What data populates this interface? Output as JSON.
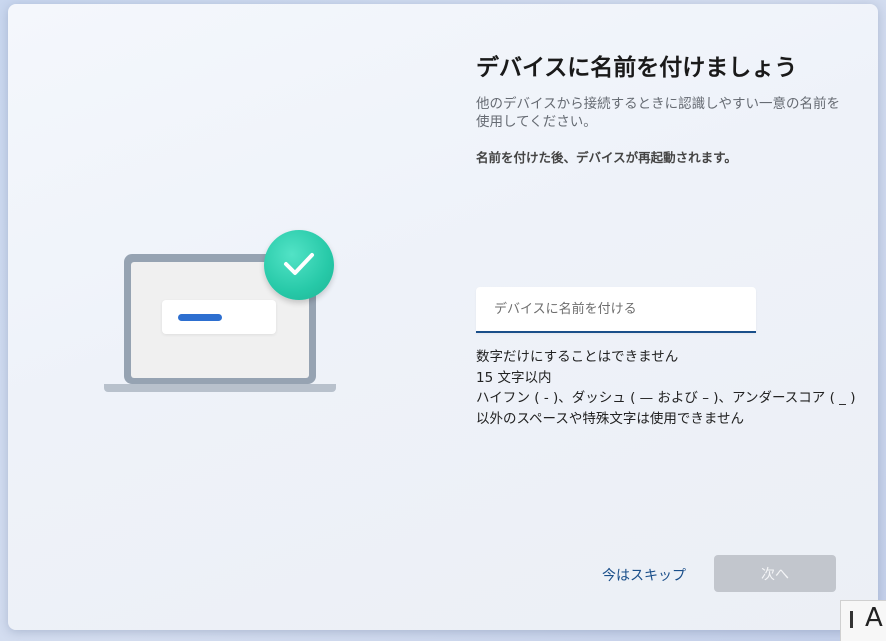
{
  "page": {
    "title": "デバイスに名前を付けましょう",
    "description": "他のデバイスから接続するときに認識しやすい一意の名前を使用してください。",
    "note": "名前を付けた後、デバイスが再起動されます。"
  },
  "name_input": {
    "placeholder": "デバイスに名前を付ける",
    "value": ""
  },
  "rules": [
    "数字だけにすることはできません",
    "15 文字以内",
    "ハイフン ( - )、ダッシュ ( — および – )、アンダースコア ( _ )",
    "以外のスペースや特殊文字は使用できません"
  ],
  "actions": {
    "skip_label": "今はスキップ",
    "next_label": "次へ"
  },
  "ime": {
    "mode_label": "A"
  },
  "illustration": {
    "laptop_icon": "laptop-icon",
    "check_icon": "checkmark-icon"
  },
  "colors": {
    "accent": "#1a4f8a",
    "check_badge": "#27c9a8",
    "disabled_button": "#c2c6cd",
    "dialog_bar": "#2d6fd0"
  }
}
